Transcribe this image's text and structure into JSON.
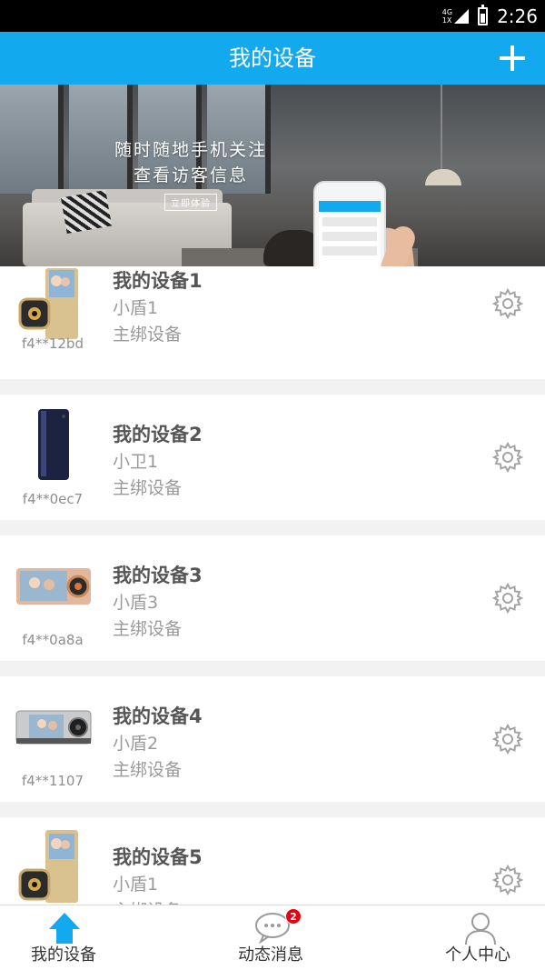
{
  "status_bar": {
    "network_top": "4G",
    "network_bottom": "1X",
    "time": "2:26"
  },
  "header": {
    "title": "我的设备",
    "add_icon": "plus-icon"
  },
  "banner": {
    "line1": "随时随地手机关注",
    "line2": "查看访客信息",
    "cta": "立即体验"
  },
  "devices": [
    {
      "name": "我的设备1",
      "model": "小盾1",
      "role": "主绑设备",
      "code": "f4**12bd",
      "thumb": "gold-door-viewer"
    },
    {
      "name": "我的设备2",
      "model": "小卫1",
      "role": "主绑设备",
      "code": "f4**0ec7",
      "thumb": "navy-tower-camera"
    },
    {
      "name": "我的设备3",
      "model": "小盾3",
      "role": "主绑设备",
      "code": "f4**0a8a",
      "thumb": "rosegold-door-viewer"
    },
    {
      "name": "我的设备4",
      "model": "小盾2",
      "role": "主绑设备",
      "code": "f4**1107",
      "thumb": "silver-door-viewer"
    },
    {
      "name": "我的设备5",
      "model": "小盾1",
      "role": "主绑设备",
      "code": "",
      "thumb": "gold-door-viewer"
    }
  ],
  "bottom_nav": [
    {
      "label": "我的设备",
      "icon": "home-icon",
      "active": true
    },
    {
      "label": "动态消息",
      "icon": "chat-bubble-icon",
      "badge": "2"
    },
    {
      "label": "个人中心",
      "icon": "person-icon"
    }
  ],
  "colors": {
    "accent": "#12a9ef",
    "badge": "#e60012",
    "text_dark": "#555555",
    "text_muted": "#9a9a9a"
  }
}
